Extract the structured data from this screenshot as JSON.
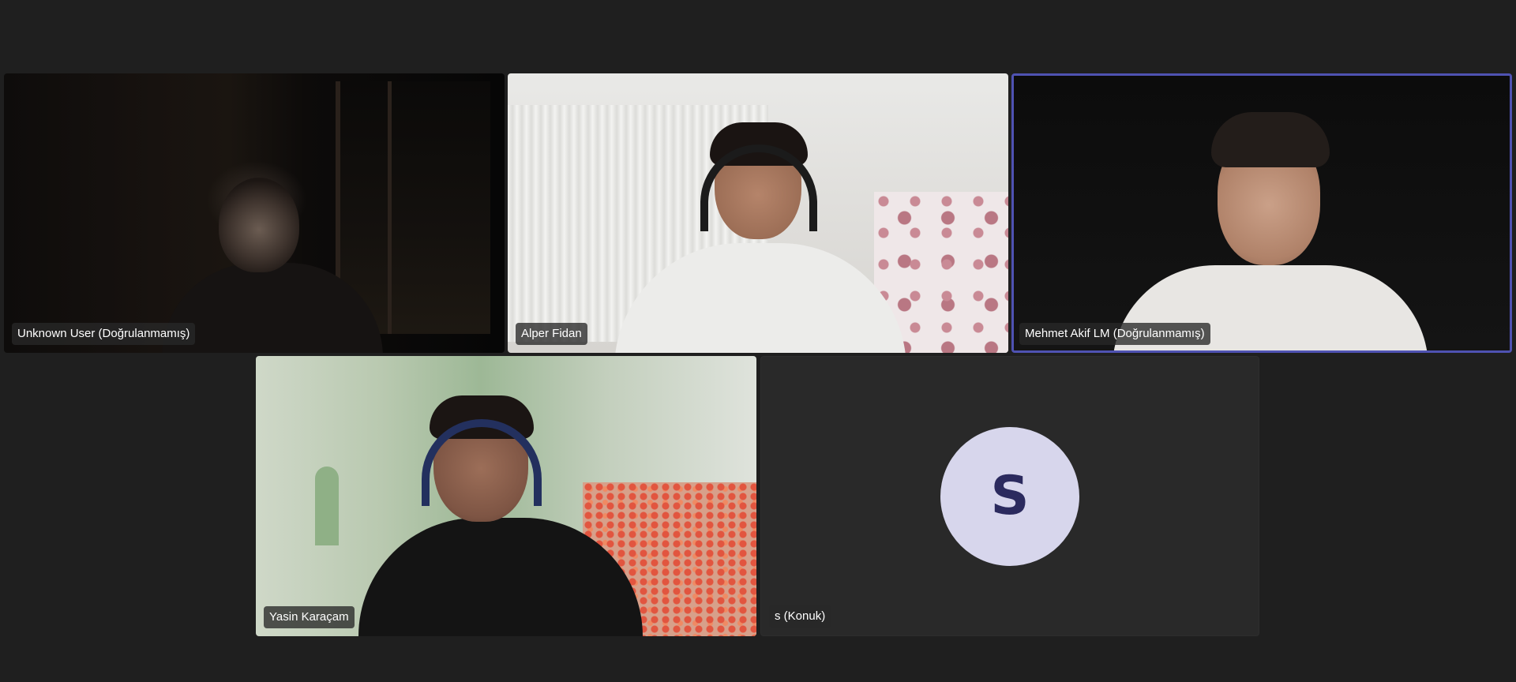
{
  "participants": [
    {
      "name": "Unknown User (Doğrulanmamış)",
      "video": true,
      "speaking": false
    },
    {
      "name": "Alper Fidan",
      "video": true,
      "speaking": false
    },
    {
      "name": "Mehmet Akif LM (Doğrulanmamış)",
      "video": true,
      "speaking": true
    },
    {
      "name": "Yasin Karaçam",
      "video": true,
      "speaking": false
    },
    {
      "name": "s (Konuk)",
      "video": false,
      "speaking": false,
      "avatar_initial": "S"
    }
  ],
  "colors": {
    "background": "#1f1f1f",
    "active_speaker_border": "#4f52b2",
    "avatar_bg": "#d7d6ec",
    "avatar_text": "#2b2a5e"
  }
}
